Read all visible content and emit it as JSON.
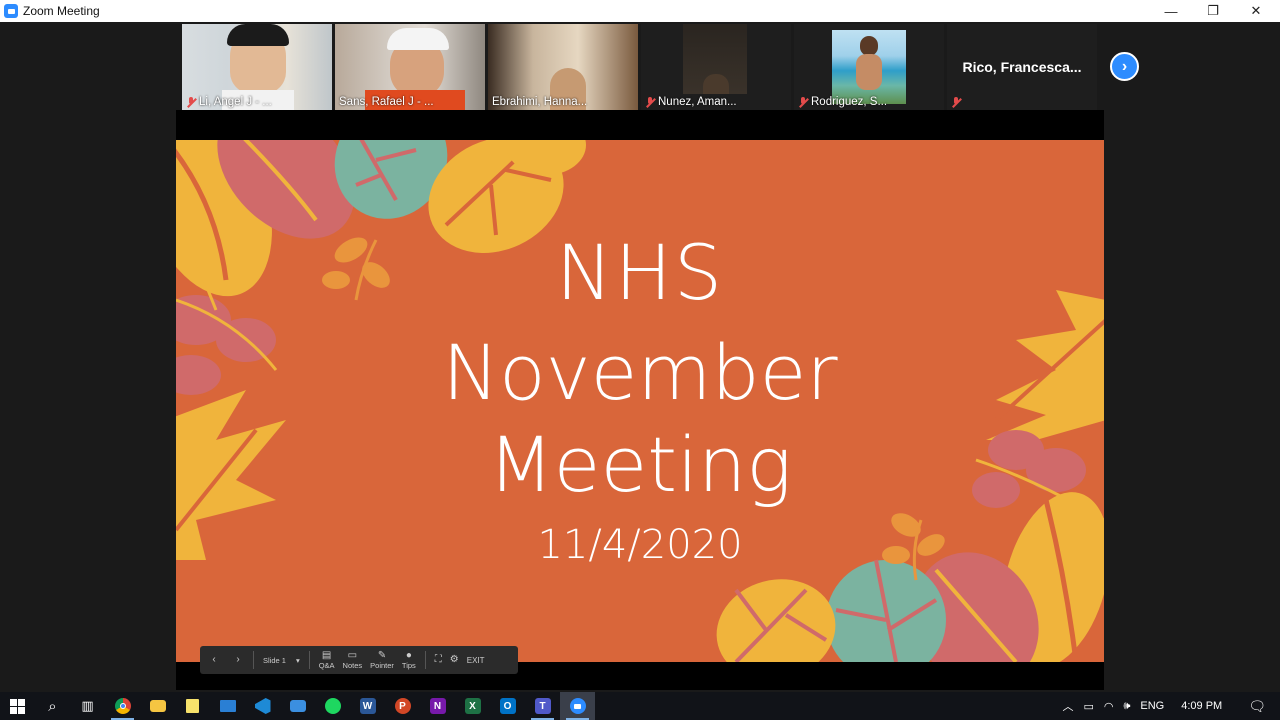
{
  "window": {
    "title": "Zoom Meeting",
    "min": "—",
    "max": "❐",
    "close": "✕"
  },
  "participants": [
    {
      "name": "Li, Angel J - ...",
      "muted": true
    },
    {
      "name": "Sans, Rafael J - ...",
      "muted": false,
      "active": true
    },
    {
      "name": "Ebrahimi, Hanna...",
      "muted": false
    },
    {
      "name": "Nunez, Aman...",
      "muted": true
    },
    {
      "name": "Rodriguez, S...",
      "muted": true
    },
    {
      "name": "Rico,  Francesca...",
      "muted": true
    }
  ],
  "next_page_icon": "chevron-right-icon",
  "slide": {
    "line1": "NHS",
    "line2": "November",
    "line3": "Meeting",
    "date": "11/4/2020",
    "colors": {
      "background": "#d9663a",
      "yellow": "#f0b43c",
      "teal": "#7bb3a0",
      "pink": "#d06a6a",
      "orange": "#e9953d"
    }
  },
  "presenter_toolbar": {
    "slide_label": "Slide 1",
    "qa": "Q&A",
    "notes": "Notes",
    "pointer": "Pointer",
    "tips": "Tips",
    "exit": "EXIT"
  },
  "taskbar": {
    "apps": [
      "windows-start-icon",
      "search-icon",
      "task-view-icon",
      "chrome-icon",
      "file-explorer-icon",
      "sticky-notes-icon",
      "mail-icon",
      "vscode-icon",
      "mail-app-icon",
      "spotify-icon",
      "word-icon",
      "powerpoint-icon",
      "onenote-icon",
      "excel-icon",
      "outlook-icon",
      "teams-icon",
      "zoom-icon"
    ],
    "app_letters": {
      "word": "W",
      "powerpoint": "P",
      "onenote": "N",
      "excel": "X",
      "outlook": "O",
      "teams": "T"
    },
    "lang": "ENG",
    "time": "4:09 PM"
  }
}
